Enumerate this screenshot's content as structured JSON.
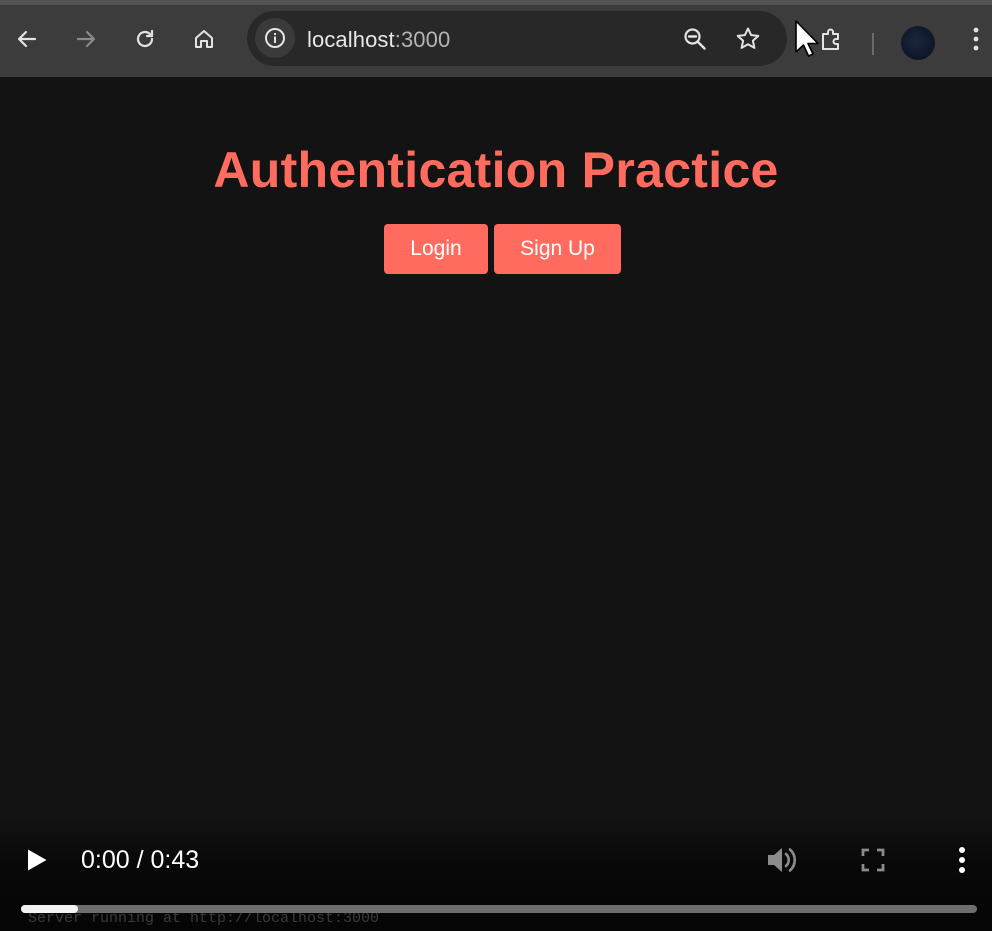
{
  "browser": {
    "url_host": "localhost",
    "url_port": ":3000",
    "icons": {
      "back": "back-arrow-icon",
      "forward": "forward-arrow-icon",
      "reload": "reload-icon",
      "home": "home-icon",
      "site_info": "info-icon",
      "zoom": "zoom-out-icon",
      "bookmark": "star-icon",
      "extensions": "puzzle-piece-icon",
      "menu": "kebab-menu-icon"
    }
  },
  "page": {
    "title": "Authentication Practice",
    "buttons": {
      "login": "Login",
      "signup": "Sign Up"
    },
    "colors": {
      "accent": "#ff6b5e",
      "background": "#131313"
    }
  },
  "video": {
    "time": "0:00 / 0:43",
    "progress_fraction": 0.06,
    "server_log": "Server running at http://localhost:3000"
  }
}
